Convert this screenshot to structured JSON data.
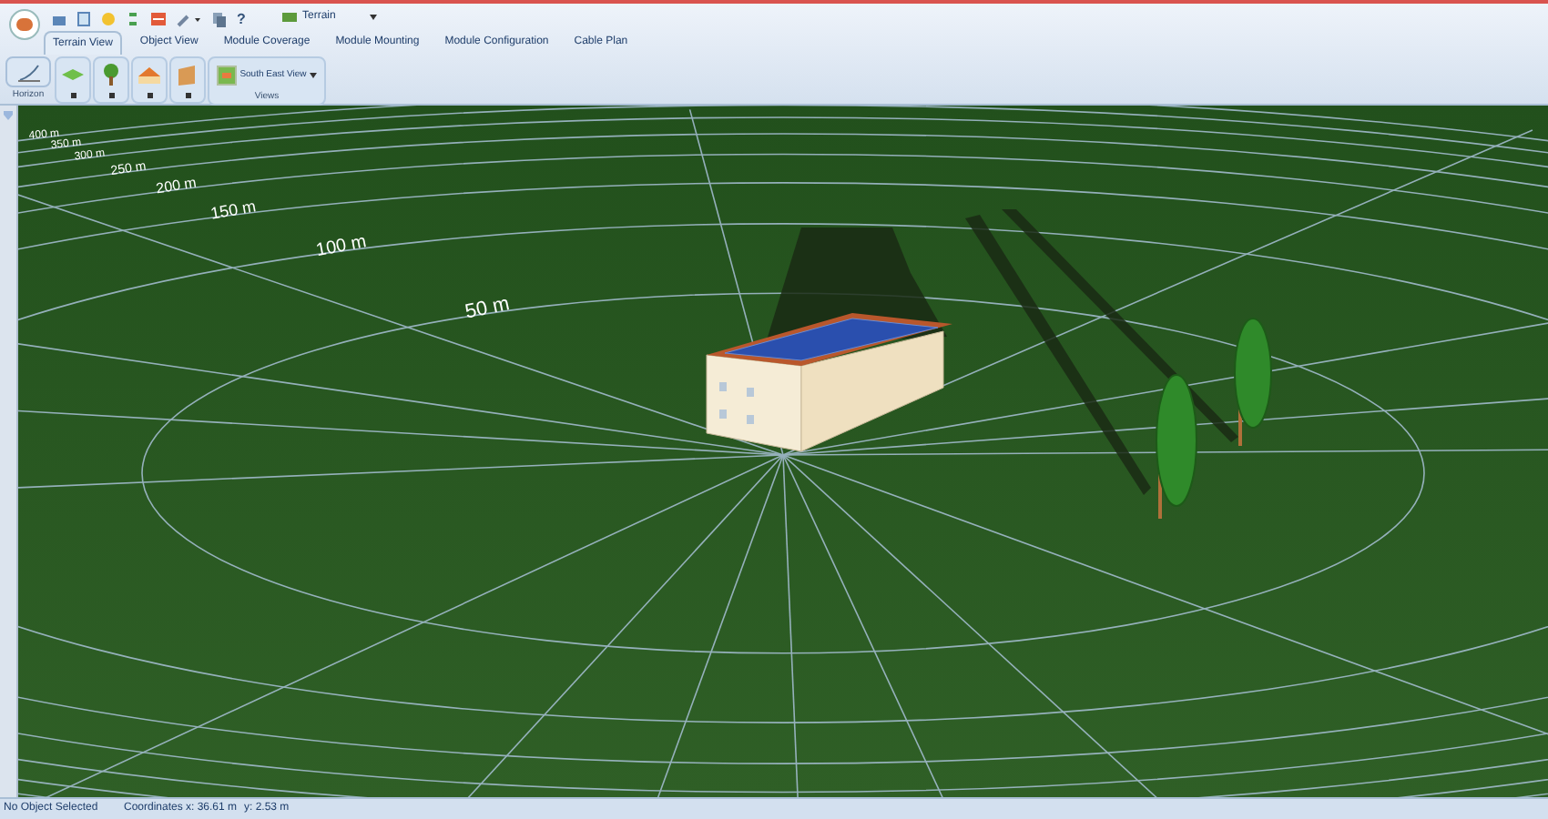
{
  "quick_access": {
    "help": "?",
    "view_dropdown": "Terrain"
  },
  "tabs": [
    {
      "label": "Terrain View",
      "selected": true
    },
    {
      "label": "Object View",
      "selected": false
    },
    {
      "label": "Module Coverage",
      "selected": false
    },
    {
      "label": "Module Mounting",
      "selected": false
    },
    {
      "label": "Module Configuration",
      "selected": false
    },
    {
      "label": "Cable Plan",
      "selected": false
    }
  ],
  "ribbon": {
    "horizon_button": "Horizon",
    "views_dropdown": "South East View",
    "views_group": "Views"
  },
  "scene": {
    "distance_labels": [
      "50 m",
      "100 m",
      "150 m",
      "200 m",
      "250 m",
      "300 m",
      "350 m",
      "400 m"
    ]
  },
  "status_bar": {
    "selection": "No Object Selected",
    "coordinates_label": "Coordinates",
    "x": "x: 36.61 m",
    "y": "y: 2.53 m"
  }
}
